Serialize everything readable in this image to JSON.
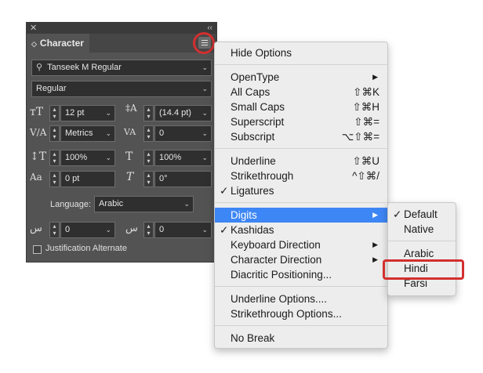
{
  "panel": {
    "title": "Character",
    "font_name": "Tanseek M Regular",
    "font_style": "Regular",
    "font_size": "12 pt",
    "leading": "(14.4 pt)",
    "kerning": "Metrics",
    "tracking": "0",
    "vertical_scale": "100%",
    "horizontal_scale": "100%",
    "baseline_shift": "0 pt",
    "skew": "0°",
    "language_label": "Language:",
    "language": "Arabic",
    "kashida_left": "0",
    "kashida_right": "0",
    "justification_alternate": "Justification Alternate"
  },
  "menu": {
    "hide_options": "Hide Options",
    "opentype": "OpenType",
    "all_caps": "All Caps",
    "all_caps_key": "⇧⌘K",
    "small_caps": "Small Caps",
    "small_caps_key": "⇧⌘H",
    "superscript": "Superscript",
    "superscript_key": "⇧⌘=",
    "subscript": "Subscript",
    "subscript_key": "⌥⇧⌘=",
    "underline": "Underline",
    "underline_key": "⇧⌘U",
    "strikethrough": "Strikethrough",
    "strikethrough_key": "^⇧⌘/",
    "ligatures": "Ligatures",
    "digits": "Digits",
    "kashidas": "Kashidas",
    "keyboard_direction": "Keyboard Direction",
    "character_direction": "Character Direction",
    "diacritic_positioning": "Diacritic Positioning...",
    "underline_options": "Underline Options....",
    "strikethrough_options": "Strikethrough Options...",
    "no_break": "No Break"
  },
  "digits_submenu": {
    "default": "Default",
    "native": "Native",
    "arabic": "Arabic",
    "hindi": "Hindi",
    "farsi": "Farsi"
  },
  "colors": {
    "highlight": "#3d86f5",
    "annotation": "#d32f2f",
    "panel_bg": "#535353"
  }
}
